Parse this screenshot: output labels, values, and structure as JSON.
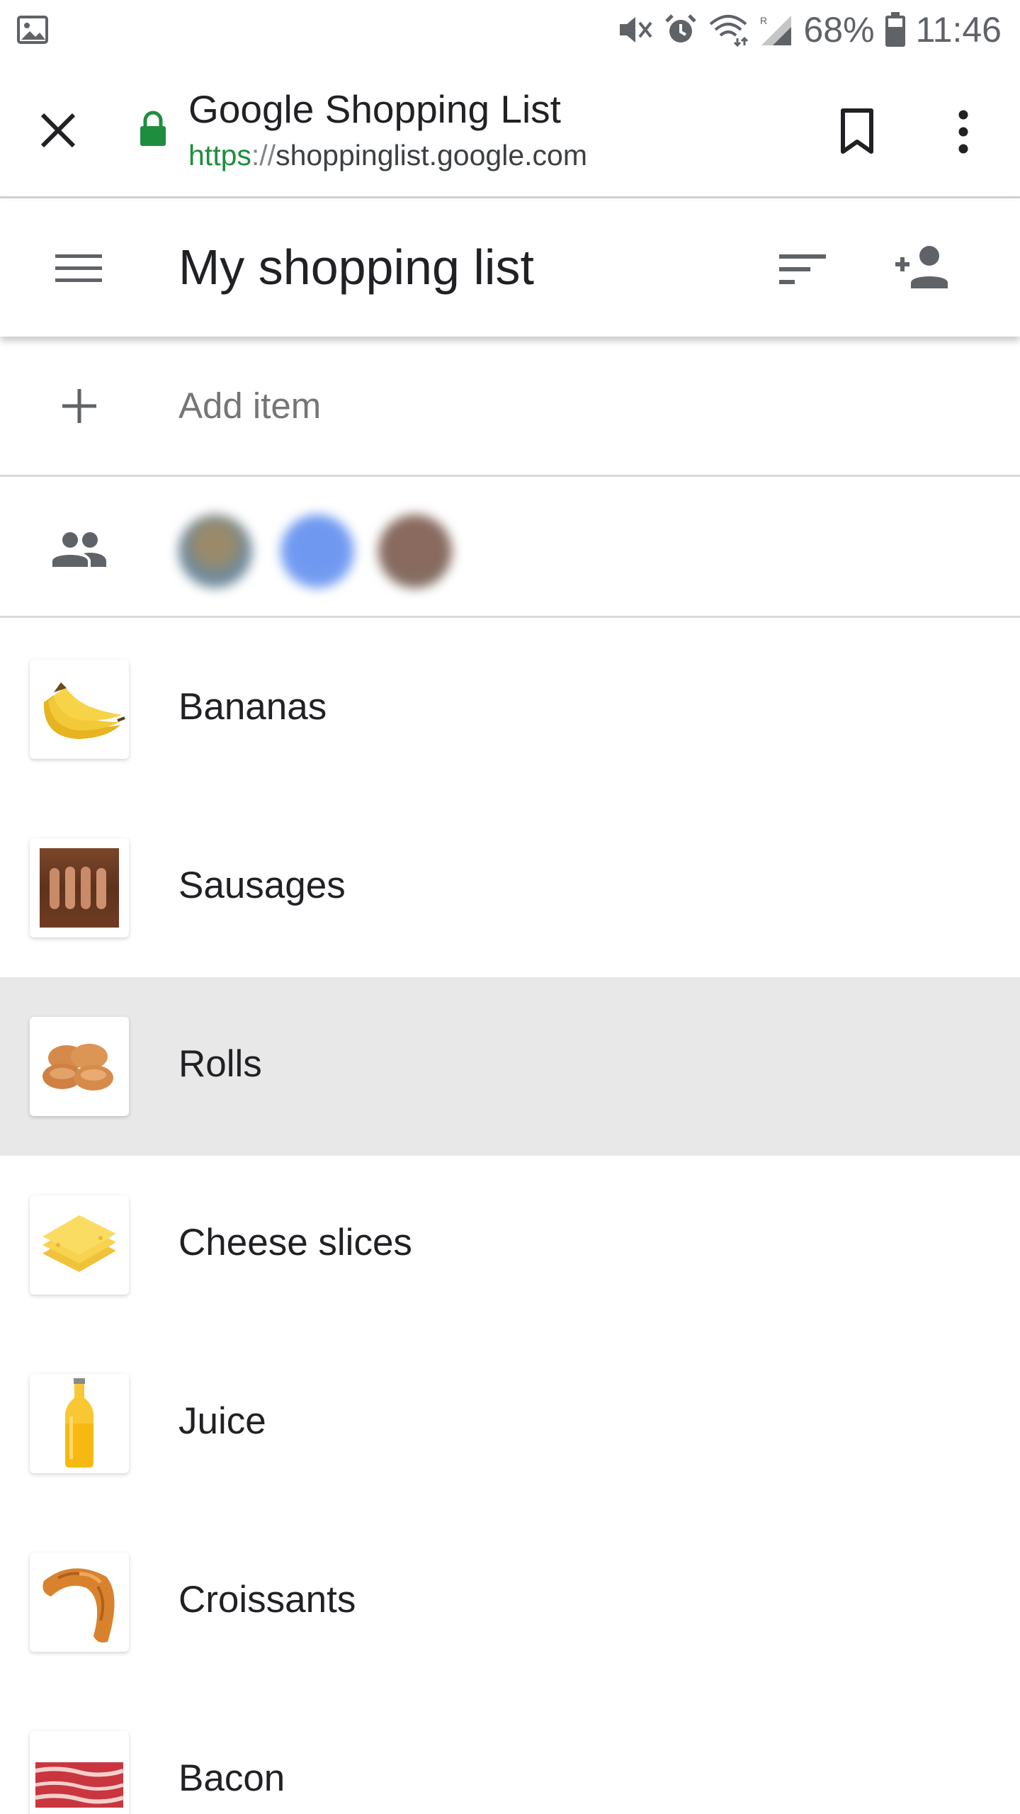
{
  "status_bar": {
    "battery_percent": "68%",
    "time": "11:46",
    "icons": [
      "gallery-notification-icon",
      "mute-icon",
      "alarm-icon",
      "wifi-icon",
      "signal-icon",
      "battery-icon"
    ]
  },
  "browser": {
    "page_title": "Google Shopping List",
    "url_scheme": "https",
    "url_separator": "://",
    "url_host": "shoppinglist.google.com",
    "icons": [
      "close-icon",
      "lock-icon",
      "bookmark-icon",
      "more-vert-icon"
    ]
  },
  "header": {
    "title": "My shopping list",
    "icons": [
      "menu-icon",
      "sort-icon",
      "add-person-icon"
    ]
  },
  "add_item": {
    "placeholder": "Add item"
  },
  "collaborators": {
    "count": 3
  },
  "items": [
    {
      "label": "Bananas",
      "image": "bananas",
      "selected": false
    },
    {
      "label": "Sausages",
      "image": "sausages",
      "selected": false
    },
    {
      "label": "Rolls",
      "image": "rolls",
      "selected": true
    },
    {
      "label": "Cheese slices",
      "image": "cheese",
      "selected": false
    },
    {
      "label": "Juice",
      "image": "juice",
      "selected": false
    },
    {
      "label": "Croissants",
      "image": "croissant",
      "selected": false
    },
    {
      "label": "Bacon",
      "image": "bacon",
      "selected": false
    }
  ],
  "colors": {
    "secure_lock": "#1e8e3e",
    "selected_row": "#e8e8e8",
    "icon_gray": "#5f6368"
  }
}
